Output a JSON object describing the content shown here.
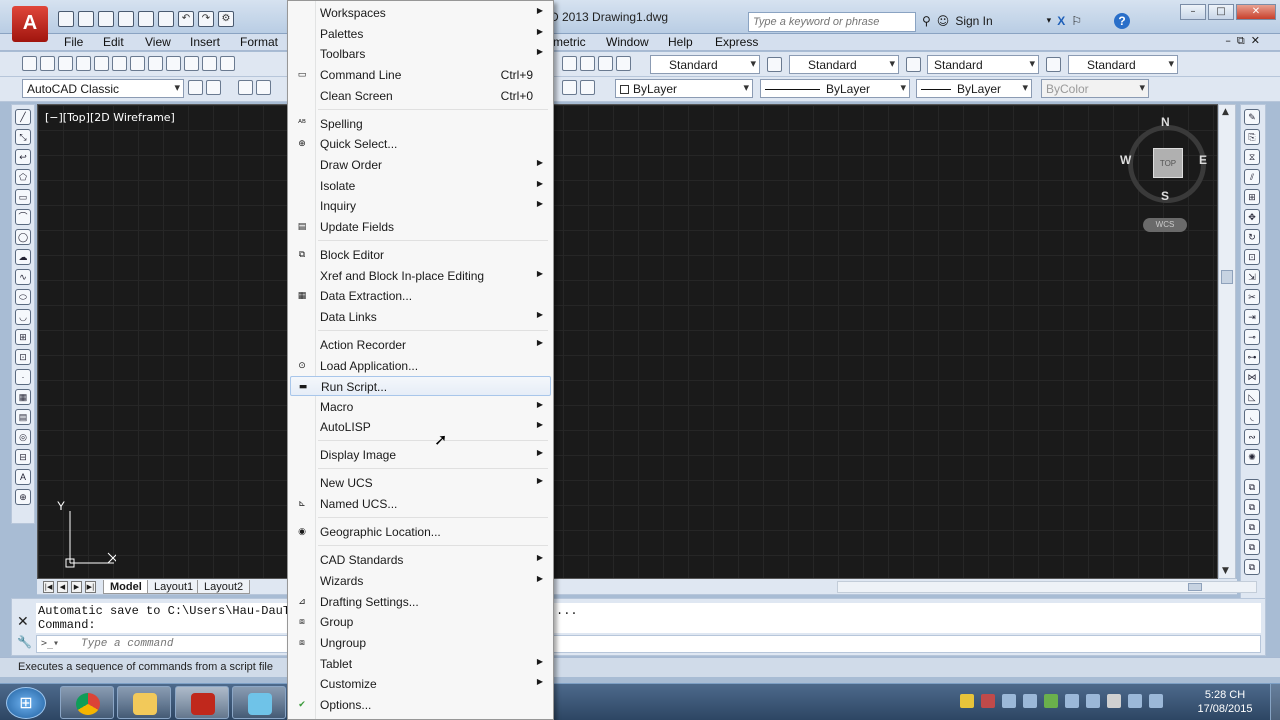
{
  "app": {
    "logo_letter": "A",
    "document_title": "D 2013       Drawing1.dwg",
    "search_placeholder": "Type a keyword or phrase",
    "sign_in": "Sign In",
    "help_label": "?"
  },
  "window_controls": {
    "minimize": "–",
    "restore": "□",
    "close": "✕"
  },
  "menubar": {
    "left_items": [
      "File",
      "Edit",
      "View",
      "Insert",
      "Format"
    ],
    "right_items": [
      "metric",
      "Window",
      "Help",
      "Express"
    ],
    "mdi": {
      "minimize": "–",
      "restore": "⧉",
      "close": "✕"
    }
  },
  "toolbar1": {
    "text_style": "Standard",
    "dim_style": "Standard",
    "table_style": "Standard",
    "mleader_style": "Standard"
  },
  "toolbar2": {
    "workspace": "AutoCAD Classic",
    "color": "ByLayer",
    "linetype": "ByLayer",
    "lineweight": "ByLayer",
    "plot_style": "ByColor"
  },
  "canvas": {
    "view_label": "[−][Top][2D Wireframe]",
    "compass": {
      "n": "N",
      "s": "S",
      "e": "E",
      "w": "W"
    },
    "viewcube_face": "TOP",
    "wcs_label": "WCS",
    "ucs_y": "Y",
    "ucs_x": "X"
  },
  "tabs": {
    "items": [
      "Model",
      "Layout1",
      "Layout2"
    ],
    "active": "Model"
  },
  "command": {
    "history_line1": "Automatic save to C:\\Users\\Hau-DauTu\\ap",
    "history_suffix": "...",
    "history_line2": "Command:",
    "input_placeholder": "Type a command"
  },
  "status_text": "Executes a sequence of commands from a script file",
  "clock": {
    "time": "5:28 CH",
    "date": "17/08/2015"
  },
  "tools_menu": {
    "items": [
      {
        "label": "Workspaces",
        "shortcut": "",
        "submenu": true,
        "icon": ""
      },
      {
        "label": "Palettes",
        "shortcut": "",
        "submenu": true,
        "icon": ""
      },
      {
        "label": "Toolbars",
        "shortcut": "",
        "submenu": true,
        "icon": ""
      },
      {
        "label": "Command Line",
        "shortcut": "Ctrl+9",
        "submenu": false,
        "icon": "command-line-icon"
      },
      {
        "label": "Clean Screen",
        "shortcut": "Ctrl+0",
        "submenu": false,
        "icon": ""
      },
      {
        "label": "Spelling",
        "shortcut": "",
        "submenu": false,
        "icon": "spelling-icon"
      },
      {
        "label": "Quick Select...",
        "shortcut": "",
        "submenu": false,
        "icon": "quick-select-icon"
      },
      {
        "label": "Draw Order",
        "shortcut": "",
        "submenu": true,
        "icon": ""
      },
      {
        "label": "Isolate",
        "shortcut": "",
        "submenu": true,
        "icon": ""
      },
      {
        "label": "Inquiry",
        "shortcut": "",
        "submenu": true,
        "icon": ""
      },
      {
        "label": "Update Fields",
        "shortcut": "",
        "submenu": false,
        "icon": "update-fields-icon"
      },
      {
        "label": "Block Editor",
        "shortcut": "",
        "submenu": false,
        "icon": "block-editor-icon"
      },
      {
        "label": "Xref and Block In-place Editing",
        "shortcut": "",
        "submenu": true,
        "icon": ""
      },
      {
        "label": "Data Extraction...",
        "shortcut": "",
        "submenu": false,
        "icon": "data-extraction-icon"
      },
      {
        "label": "Data Links",
        "shortcut": "",
        "submenu": true,
        "icon": ""
      },
      {
        "label": "Action Recorder",
        "shortcut": "",
        "submenu": true,
        "icon": ""
      },
      {
        "label": "Load Application...",
        "shortcut": "",
        "submenu": false,
        "icon": "load-application-icon"
      },
      {
        "label": "Run Script...",
        "shortcut": "",
        "submenu": false,
        "icon": "run-script-icon"
      },
      {
        "label": "Macro",
        "shortcut": "",
        "submenu": true,
        "icon": ""
      },
      {
        "label": "AutoLISP",
        "shortcut": "",
        "submenu": true,
        "icon": ""
      },
      {
        "label": "Display Image",
        "shortcut": "",
        "submenu": true,
        "icon": ""
      },
      {
        "label": "New UCS",
        "shortcut": "",
        "submenu": true,
        "icon": ""
      },
      {
        "label": "Named UCS...",
        "shortcut": "",
        "submenu": false,
        "icon": "named-ucs-icon"
      },
      {
        "label": "Geographic Location...",
        "shortcut": "",
        "submenu": false,
        "icon": "geographic-location-icon"
      },
      {
        "label": "CAD Standards",
        "shortcut": "",
        "submenu": true,
        "icon": ""
      },
      {
        "label": "Wizards",
        "shortcut": "",
        "submenu": true,
        "icon": ""
      },
      {
        "label": "Drafting Settings...",
        "shortcut": "",
        "submenu": false,
        "icon": "drafting-settings-icon"
      },
      {
        "label": "Group",
        "shortcut": "",
        "submenu": false,
        "icon": "group-icon"
      },
      {
        "label": "Ungroup",
        "shortcut": "",
        "submenu": false,
        "icon": "ungroup-icon"
      },
      {
        "label": "Tablet",
        "shortcut": "",
        "submenu": true,
        "icon": ""
      },
      {
        "label": "Customize",
        "shortcut": "",
        "submenu": true,
        "icon": ""
      },
      {
        "label": "Options...",
        "shortcut": "",
        "submenu": false,
        "icon": "options-icon"
      }
    ],
    "highlighted": "Run Script...",
    "submenu_arrow": "▶"
  },
  "colors": {
    "canvas_bg": "#1a1a1a",
    "menu_highlight_border": "#a8c6ea",
    "title_red": "#c0281c"
  }
}
